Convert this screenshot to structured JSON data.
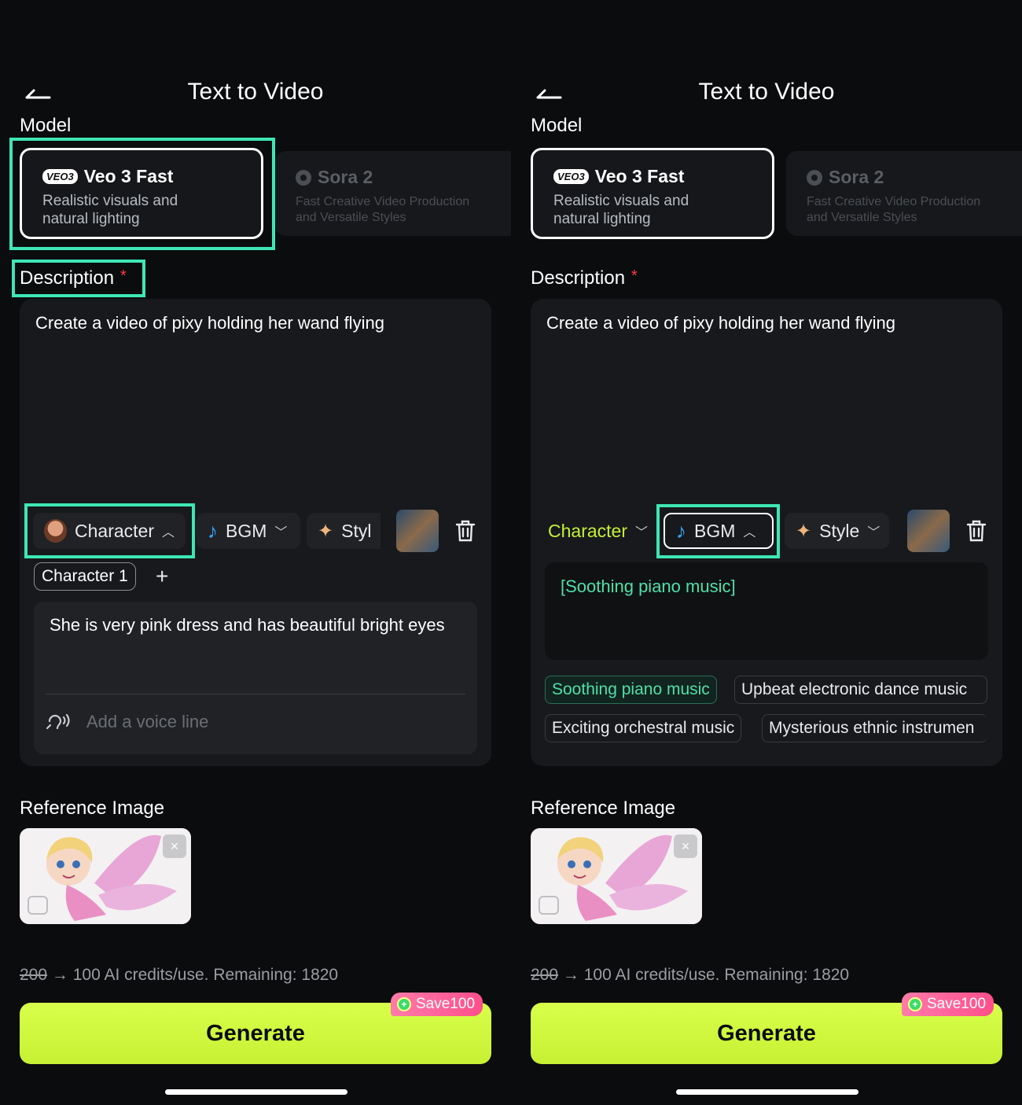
{
  "header": {
    "title": "Text to Video",
    "back_label": "back"
  },
  "model": {
    "label": "Model",
    "options": [
      {
        "badge": "VEO3",
        "name": "Veo 3 Fast",
        "desc_line1": "Realistic visuals and",
        "desc_line2": "natural lighting"
      },
      {
        "name": "Sora 2",
        "desc_line1": "Fast Creative Video Production",
        "desc_line2": "and Versatile Styles"
      }
    ]
  },
  "description": {
    "label": "Description",
    "required_mark": "*",
    "text": "Create a video of pixy holding her wand flying"
  },
  "toolbar": {
    "character_label": "Character",
    "bgm_label": "BGM",
    "style_label": "Style",
    "style_label_truncated": "Styl"
  },
  "character": {
    "tag": "Character 1",
    "add": "+",
    "text": "She is very pink dress and has beautiful bright eyes",
    "voice_placeholder": "Add a voice line"
  },
  "bgm": {
    "selected_text": "[Soothing piano music]",
    "options": [
      "Soothing piano music",
      "Upbeat electronic dance music",
      "Exciting orchestral music",
      "Mysterious ethnic instrumen"
    ]
  },
  "reference": {
    "label": "Reference Image",
    "close": "×"
  },
  "credits": {
    "old": "200",
    "arrow": "→",
    "text": "100 AI credits/use. Remaining: 1820"
  },
  "generate": {
    "label": "Generate",
    "badge": "Save100"
  },
  "colors": {
    "accent": "#c7f034",
    "highlight": "#3ee6b5",
    "bgm_text": "#4fe0a8",
    "required": "#ff3b4a"
  }
}
